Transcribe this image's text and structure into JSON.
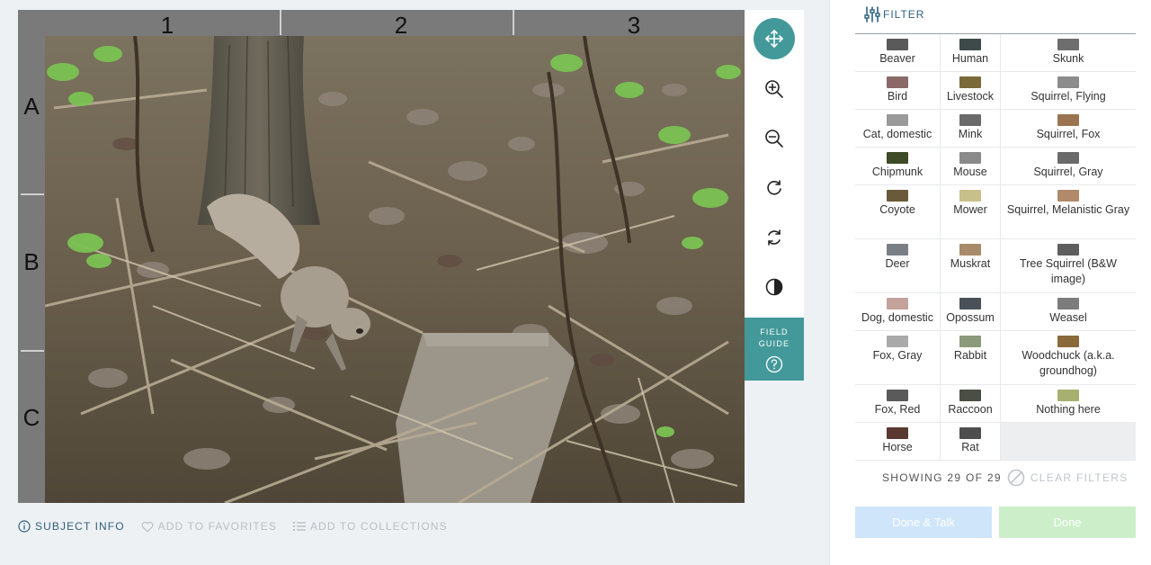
{
  "viewer": {
    "grid_columns": [
      "1",
      "2",
      "3"
    ],
    "grid_rows": [
      "A",
      "B",
      "C"
    ]
  },
  "toolbar": {
    "tools": [
      {
        "name": "move",
        "icon": "move-icon",
        "active": true
      },
      {
        "name": "zoom-in",
        "icon": "zoom-in-icon"
      },
      {
        "name": "zoom-out",
        "icon": "zoom-out-icon"
      },
      {
        "name": "rotate",
        "icon": "rotate-icon"
      },
      {
        "name": "reset",
        "icon": "reset-icon"
      },
      {
        "name": "invert",
        "icon": "contrast-icon"
      }
    ],
    "field_guide_label": "FIELD GUIDE",
    "accent": "#43999a"
  },
  "meta": {
    "subject_info": "SUBJECT INFO",
    "favorites": "ADD TO FAVORITES",
    "collections": "ADD TO COLLECTIONS"
  },
  "panel": {
    "filter_label": "FILTER",
    "choices": [
      {
        "label": "Beaver",
        "thumb": "#5a5a5a"
      },
      {
        "label": "Human",
        "thumb": "#3e4a4a"
      },
      {
        "label": "Skunk",
        "thumb": "#6e6e6e"
      },
      {
        "label": "Bird",
        "thumb": "#8a6a68"
      },
      {
        "label": "Livestock",
        "thumb": "#7a6a3a"
      },
      {
        "label": "Squirrel, Flying",
        "thumb": "#8c8c8c"
      },
      {
        "label": "Cat, domestic",
        "thumb": "#9a9a9a"
      },
      {
        "label": "Mink",
        "thumb": "#6a6a6a"
      },
      {
        "label": "Squirrel, Fox",
        "thumb": "#9a7450"
      },
      {
        "label": "Chipmunk",
        "thumb": "#3f4a28"
      },
      {
        "label": "Mouse",
        "thumb": "#8a8a8a"
      },
      {
        "label": "Squirrel, Gray",
        "thumb": "#6a6a6a"
      },
      {
        "label": "Coyote",
        "thumb": "#6a5a3a"
      },
      {
        "label": "Mower",
        "thumb": "#c8c08a"
      },
      {
        "label": "Squirrel, Melanistic Gray",
        "thumb": "#b08a6a"
      },
      {
        "label": "Deer",
        "thumb": "#7a7f86"
      },
      {
        "label": "Muskrat",
        "thumb": "#a88a6a"
      },
      {
        "label": "Tree Squirrel (B&W image)",
        "thumb": "#5e5e5e"
      },
      {
        "label": "Dog, domestic",
        "thumb": "#c2a29a"
      },
      {
        "label": "Opossum",
        "thumb": "#4a5058"
      },
      {
        "label": "Weasel",
        "thumb": "#7c7c7c"
      },
      {
        "label": "Fox, Gray",
        "thumb": "#aaaaaa"
      },
      {
        "label": "Rabbit",
        "thumb": "#8a9a7a"
      },
      {
        "label": "Woodchuck (a.k.a. groundhog)",
        "thumb": "#8a6a3a"
      },
      {
        "label": "Fox, Red",
        "thumb": "#5a5a5a"
      },
      {
        "label": "Raccoon",
        "thumb": "#4a4e44"
      },
      {
        "label": "Nothing here",
        "thumb": "#a8b070"
      },
      {
        "label": "Horse",
        "thumb": "#5a3a30"
      },
      {
        "label": "Rat",
        "thumb": "#4e4e4e"
      }
    ],
    "showing_text": "SHOWING 29 OF 29",
    "clear_filters": "CLEAR FILTERS",
    "done_talk": "Done & Talk",
    "done": "Done"
  }
}
